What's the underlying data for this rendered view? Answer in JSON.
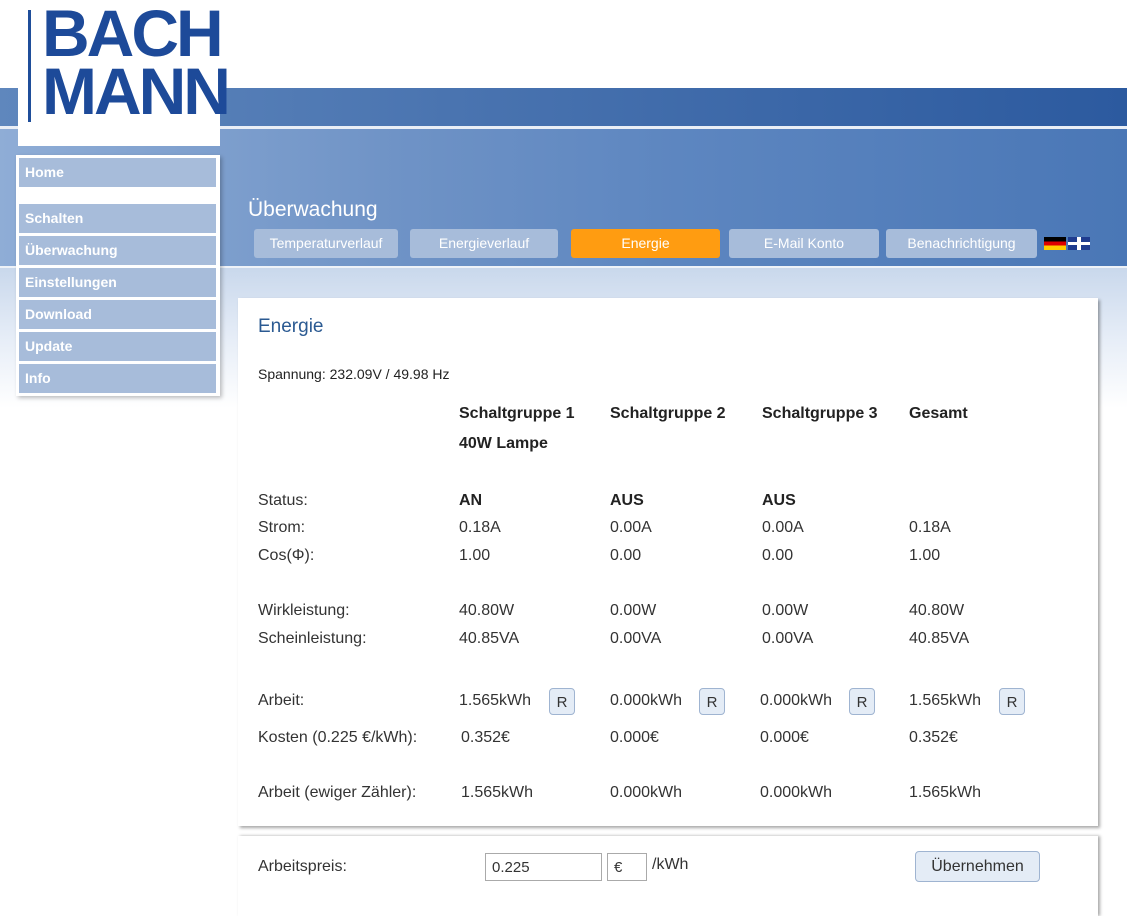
{
  "logo": {
    "line1": "BACH",
    "line2": "MANN"
  },
  "sidebar": {
    "items": [
      {
        "label": "Home"
      },
      {
        "label": "Schalten"
      },
      {
        "label": "Überwachung"
      },
      {
        "label": "Einstellungen"
      },
      {
        "label": "Download"
      },
      {
        "label": "Update"
      },
      {
        "label": "Info"
      }
    ]
  },
  "header": {
    "title": "Überwachung",
    "tabs": [
      {
        "label": "Temperaturverlauf"
      },
      {
        "label": "Energieverlauf"
      },
      {
        "label": "Energie",
        "active": true
      },
      {
        "label": "E-Mail Konto"
      },
      {
        "label": "Benachrichtigung"
      }
    ],
    "flags": [
      "flag-de-icon",
      "flag-uk-icon"
    ]
  },
  "energy": {
    "title": "Energie",
    "voltage": "Spannung: 232.09V / 49.98 Hz",
    "columns": [
      {
        "name": "Schaltgruppe 1",
        "sub": "40W Lampe"
      },
      {
        "name": "Schaltgruppe 2",
        "sub": ""
      },
      {
        "name": "Schaltgruppe 3",
        "sub": ""
      },
      {
        "name": "Gesamt",
        "sub": ""
      }
    ],
    "labels": {
      "status": "Status:",
      "strom": "Strom:",
      "cos": "Cos(Φ):",
      "wirk": "Wirkleistung:",
      "schein": "Scheinleistung:",
      "arbeit": "Arbeit:",
      "kosten": "Kosten (0.225 €/kWh):",
      "ewig": "Arbeit (ewiger Zähler):"
    },
    "status": [
      "AN",
      "AUS",
      "AUS",
      ""
    ],
    "strom": [
      "0.18A",
      "0.00A",
      "0.00A",
      "0.18A"
    ],
    "cos": [
      "1.00",
      "0.00",
      "0.00",
      "1.00"
    ],
    "wirk": [
      "40.80W",
      "0.00W",
      "0.00W",
      "40.80W"
    ],
    "schein": [
      "40.85VA",
      "0.00VA",
      "0.00VA",
      "40.85VA"
    ],
    "arbeit": [
      "1.565kWh",
      "0.000kWh",
      "0.000kWh",
      "1.565kWh"
    ],
    "reset_label": "R",
    "kosten": [
      "0.352€",
      "0.000€",
      "0.000€",
      "0.352€"
    ],
    "ewig": [
      "1.565kWh",
      "0.000kWh",
      "0.000kWh",
      "1.565kWh"
    ]
  },
  "price": {
    "label": "Arbeitspreis:",
    "value": "0.225",
    "currency": "€",
    "unit": "/kWh",
    "apply_label": "Übernehmen"
  }
}
